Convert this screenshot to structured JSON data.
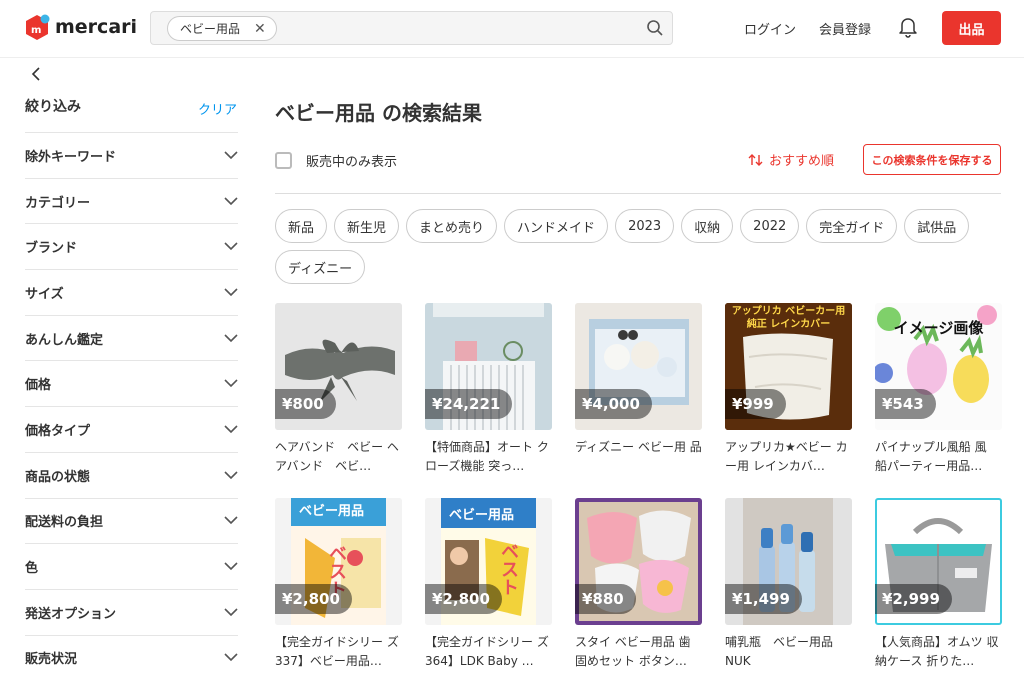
{
  "header": {
    "logo_text": "mercari",
    "search_chip": "ベビー用品",
    "login": "ログイン",
    "register": "会員登録",
    "sell": "出品"
  },
  "sidebar": {
    "title": "絞り込み",
    "clear": "クリア",
    "items": [
      "除外キーワード",
      "カテゴリー",
      "ブランド",
      "サイズ",
      "あんしん鑑定",
      "価格",
      "価格タイプ",
      "商品の状態",
      "配送料の負担",
      "色",
      "発送オプション",
      "販売状況"
    ]
  },
  "main": {
    "title": "ベビー用品 の検索結果",
    "on_sale_only": "販売中のみ表示",
    "sort": "おすすめ順",
    "save_search": "この検索条件を保存する",
    "tags": [
      "新品",
      "新生児",
      "まとめ売り",
      "ハンドメイド",
      "2023",
      "収納",
      "2022",
      "完全ガイド",
      "試供品",
      "ディズニー"
    ],
    "products": [
      {
        "price": "¥800",
        "name": "ヘアバンド　ベビー ヘアバンド　ベビ…"
      },
      {
        "price": "¥24,221",
        "name": "【特価商品】オート クローズ機能 突っ…"
      },
      {
        "price": "¥4,000",
        "name": "ディズニー ベビー用 品"
      },
      {
        "price": "¥999",
        "name": "アップリカ★ベビー カー用 レインカバ…",
        "thumb_text1": "アップリカ ベビーカー用",
        "thumb_text2": "純正 レインカバー"
      },
      {
        "price": "¥543",
        "name": "パイナップル風船 風 船パーティー用品…",
        "thumb_text1": "イメージ画像"
      },
      {
        "price": "¥2,800",
        "name": "【完全ガイドシリー ズ337】ベビー用品…",
        "thumb_text1": "ベビー用品",
        "thumb_text2": "ベスト"
      },
      {
        "price": "¥2,800",
        "name": "【完全ガイドシリー ズ364】LDK Baby …",
        "thumb_text1": "ベビー用品",
        "thumb_text2": "ベスト"
      },
      {
        "price": "¥880",
        "name": "スタイ ベビー用品 歯 固めセット ボタン…"
      },
      {
        "price": "¥1,499",
        "name": "哺乳瓶　ベビー用品 NUK"
      },
      {
        "price": "¥2,999",
        "name": "【人気商品】オムツ 収納ケース 折りた…"
      }
    ]
  },
  "colors": {
    "brand_red": "#ea352d",
    "link_blue": "#0095ee",
    "selected_outline": "#3ccbe0"
  }
}
